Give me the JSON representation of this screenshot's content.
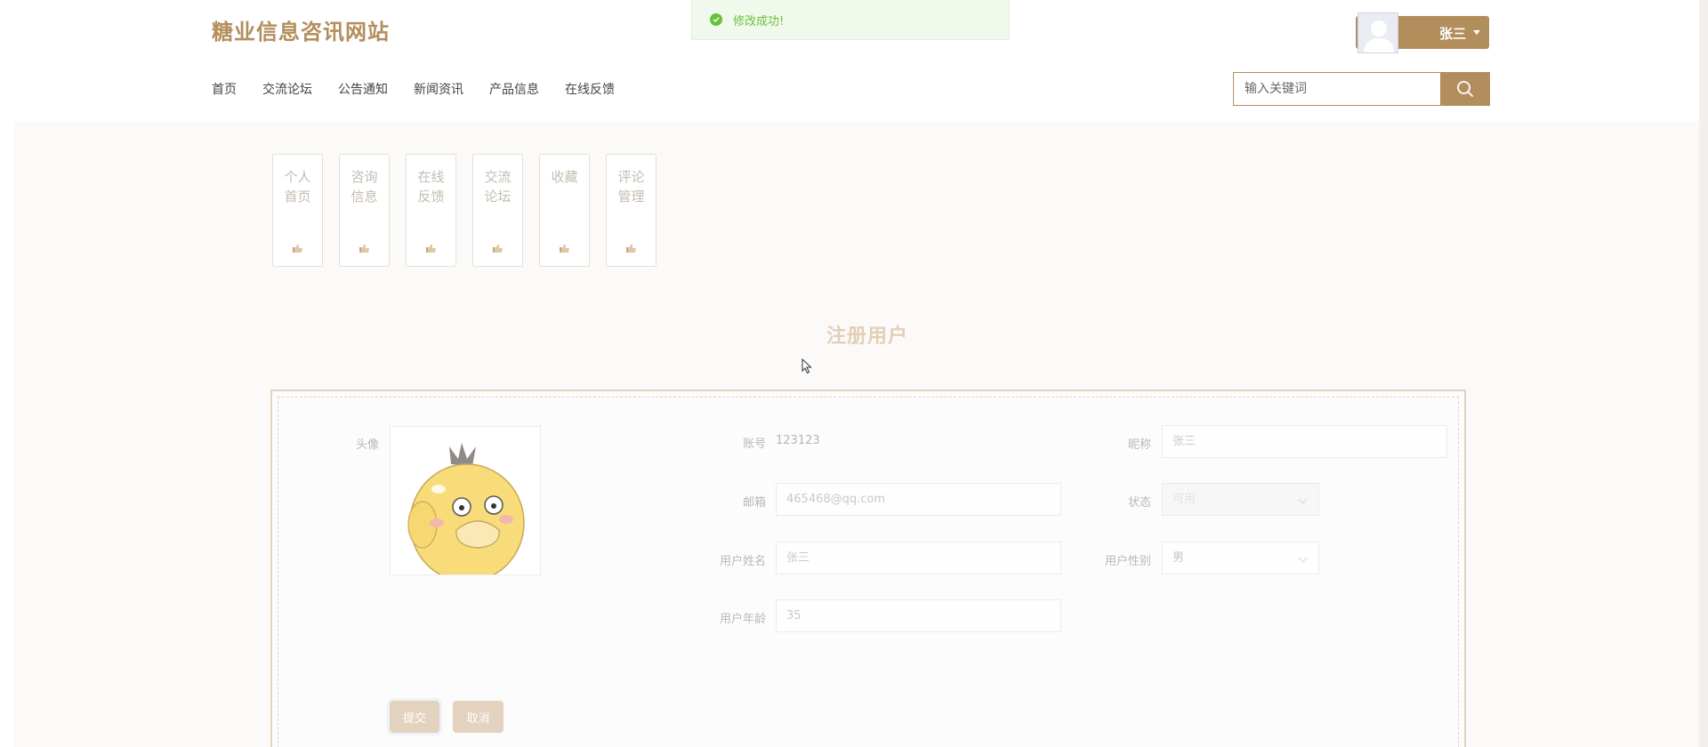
{
  "site": {
    "title": "糖业信息咨讯网站"
  },
  "nav": {
    "items": [
      "首页",
      "交流论坛",
      "公告通知",
      "新闻资讯",
      "产品信息",
      "在线反馈"
    ]
  },
  "user": {
    "name": "张三"
  },
  "search": {
    "placeholder": "输入关键词"
  },
  "toast": {
    "message": "修改成功!"
  },
  "side_menu": {
    "items": [
      {
        "label": "个人首页"
      },
      {
        "label": "咨询信息"
      },
      {
        "label": "在线反馈"
      },
      {
        "label": "交流论坛"
      },
      {
        "label": "收藏"
      },
      {
        "label": "评论管理"
      }
    ]
  },
  "page": {
    "title": "注册用户"
  },
  "form": {
    "avatar_label": "头像",
    "account_label": "账号",
    "account_value": "123123",
    "nickname_label": "昵称",
    "nickname_value": "张三",
    "email_label": "邮箱",
    "email_value": "465468@qq.com",
    "status_label": "状态",
    "status_value": "可用",
    "name_label": "用户姓名",
    "name_value": "张三",
    "gender_label": "用户性别",
    "gender_value": "男",
    "age_label": "用户年龄",
    "age_value": "35",
    "submit_label": "提交",
    "cancel_label": "取消"
  },
  "colors": {
    "brand": "#b38e5d",
    "success": "#67c23a"
  }
}
